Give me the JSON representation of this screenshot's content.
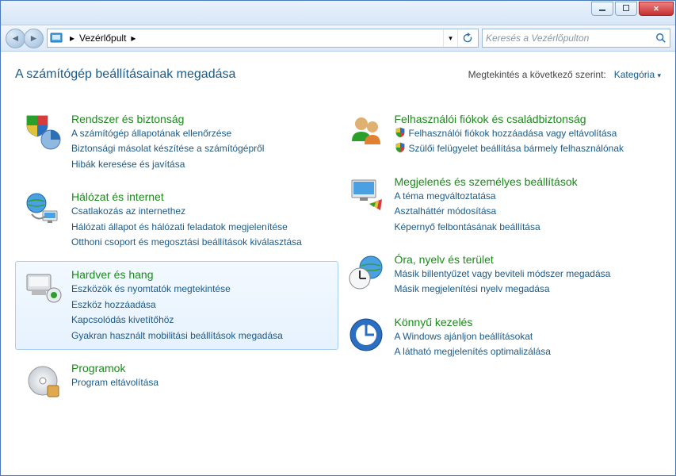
{
  "breadcrumb": {
    "root": "Vezérlőpult"
  },
  "search": {
    "placeholder": "Keresés a Vezérlőpulton"
  },
  "page": {
    "title": "A számítógép beállításainak megadása",
    "view_by_label": "Megtekintés a következő szerint:",
    "view_by_value": "Kategória"
  },
  "left": [
    {
      "id": "system-security",
      "title": "Rendszer és biztonság",
      "links": [
        {
          "text": "A számítógép állapotának ellenőrzése"
        },
        {
          "text": "Biztonsági másolat készítése a számítógépről"
        },
        {
          "text": "Hibák keresése és javítása"
        }
      ]
    },
    {
      "id": "network-internet",
      "title": "Hálózat és internet",
      "links": [
        {
          "text": "Csatlakozás az internethez"
        },
        {
          "text": "Hálózati állapot és hálózati feladatok megjelenítése"
        },
        {
          "text": "Otthoni csoport és megosztási beállítások kiválasztása"
        }
      ]
    },
    {
      "id": "hardware-sound",
      "title": "Hardver és hang",
      "hover": true,
      "links": [
        {
          "text": "Eszközök és nyomtatók megtekintése"
        },
        {
          "text": "Eszköz hozzáadása"
        },
        {
          "text": "Kapcsolódás kivetítőhöz"
        },
        {
          "text": "Gyakran használt mobilitási beállítások megadása"
        }
      ]
    },
    {
      "id": "programs",
      "title": "Programok",
      "links": [
        {
          "text": "Program eltávolítása"
        }
      ]
    }
  ],
  "right": [
    {
      "id": "user-accounts",
      "title": "Felhasználói fiókok és családbiztonság",
      "links": [
        {
          "text": "Felhasználói fiókok hozzáadása vagy eltávolítása",
          "shield": true
        },
        {
          "text": "Szülői felügyelet beállítása bármely felhasználónak",
          "shield": true
        }
      ]
    },
    {
      "id": "appearance",
      "title": "Megjelenés és személyes beállítások",
      "links": [
        {
          "text": "A téma megváltoztatása"
        },
        {
          "text": "Asztalháttér módosítása"
        },
        {
          "text": "Képernyő felbontásának beállítása"
        }
      ]
    },
    {
      "id": "clock-language-region",
      "title": "Óra, nyelv és terület",
      "links": [
        {
          "text": "Másik billentyűzet vagy beviteli módszer megadása"
        },
        {
          "text": "Másik megjelenítési nyelv megadása"
        }
      ]
    },
    {
      "id": "ease-of-access",
      "title": "Könnyű kezelés",
      "links": [
        {
          "text": "A Windows ajánljon beállításokat"
        },
        {
          "text": "A látható megjelenítés optimalizálása"
        }
      ]
    }
  ]
}
